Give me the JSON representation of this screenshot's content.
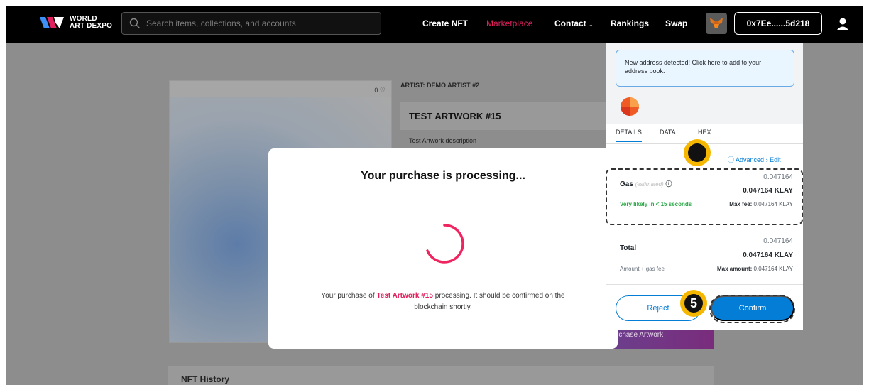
{
  "brand": {
    "line1": "WORLD",
    "line2": "ART DEXPO"
  },
  "search": {
    "placeholder": "Search items, collections, and accounts"
  },
  "nav": {
    "create": "Create NFT",
    "marketplace": "Marketplace",
    "contact": "Contact",
    "rankings": "Rankings",
    "swap": "Swap"
  },
  "wallet_address": "0x7Ee......5d218",
  "product": {
    "likes": "0",
    "artist": "ARTIST: DEMO ARTIST #2",
    "title": "TEST ARTWORK #15",
    "description": "Test Artwork description",
    "purchase_label": "rchase Artwork",
    "history_title": "NFT History"
  },
  "modal": {
    "title": "Your purchase is processing...",
    "text_before": "Your purchase of ",
    "artwork_name": "Test Artwork #15",
    "text_after": " processing. It should be confirmed on the blockchain shortly."
  },
  "metamask": {
    "notice": "New address detected! Click here to add to your address book.",
    "tabs": [
      "DETAILS",
      "DATA",
      "HEX"
    ],
    "advanced": "Advanced",
    "edit": "Edit",
    "gas_value_small": "0.047164",
    "gas_label": "Gas",
    "gas_estimated": "(estimated)",
    "gas_value_strong": "0.047164 KLAY",
    "likely": "Very likely in < 15 seconds",
    "max_fee_label": "Max fee:",
    "max_fee_value": "0.047164 KLAY",
    "total_value_small": "0.047164",
    "total_label": "Total",
    "total_value_strong": "0.047164 KLAY",
    "amount_gas": "Amount + gas fee",
    "max_amount_label": "Max amount:",
    "max_amount_value": "0.047164 KLAY",
    "reject": "Reject",
    "confirm": "Confirm"
  },
  "annotations": {
    "step5": "5",
    "step_blank": ""
  },
  "colors": {
    "accent": "#e0215e",
    "metamask_blue": "#037dd6",
    "badge": "#f6b700"
  }
}
